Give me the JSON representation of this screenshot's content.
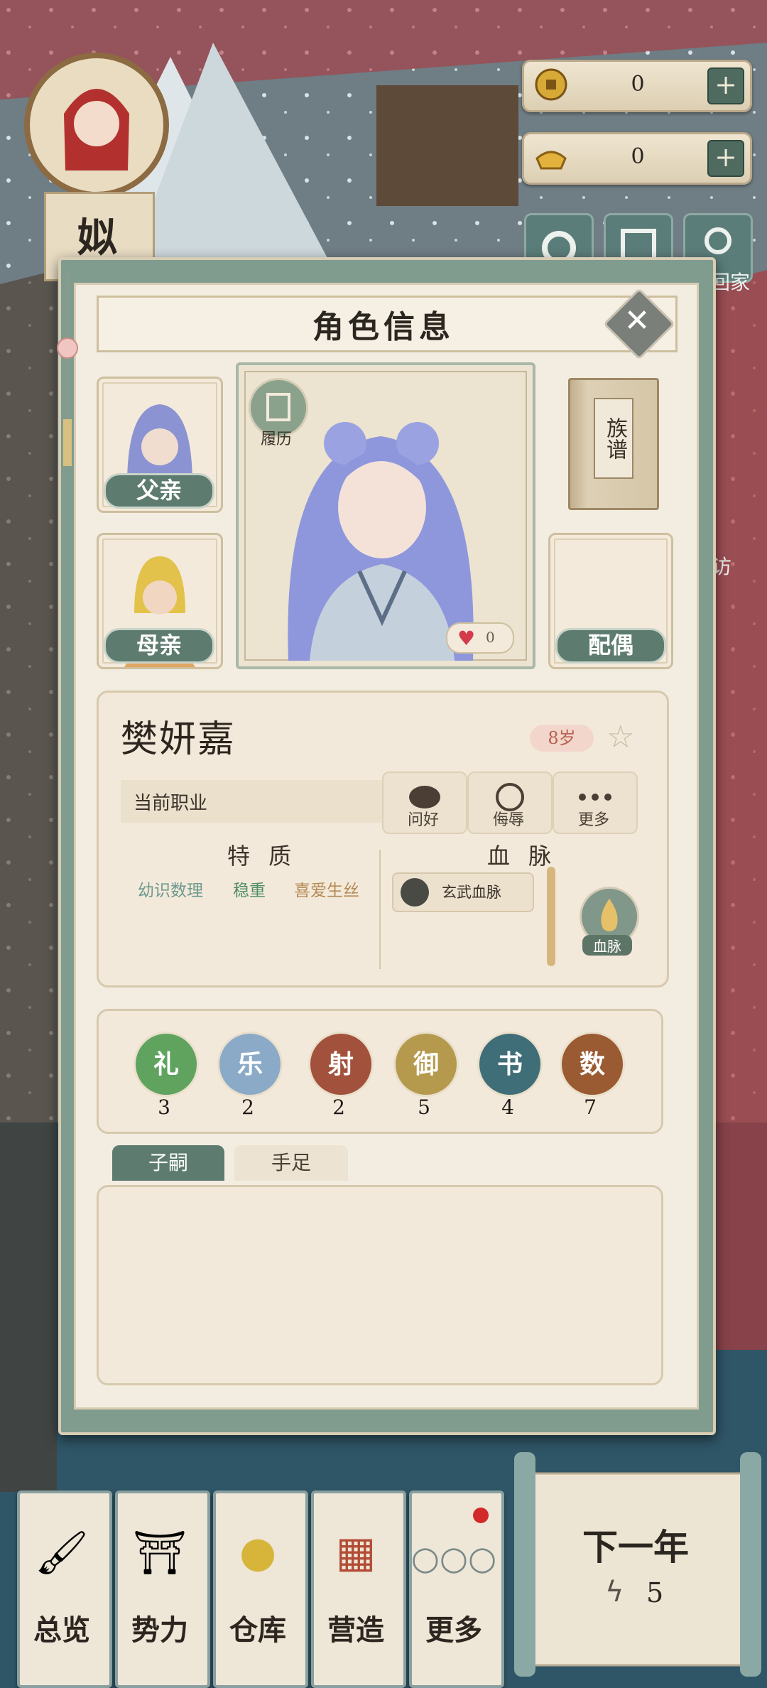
{
  "player": {
    "name_char": "姒"
  },
  "resources": [
    {
      "icon": "copper-coin-icon",
      "value": "0"
    },
    {
      "icon": "gold-ingot-icon",
      "value": "0"
    }
  ],
  "top_buttons": {
    "visit_home_label": "回家",
    "visit_label": "访"
  },
  "panel": {
    "title": "角色信息",
    "resume_label": "履历",
    "genealogy_label": "族谱",
    "father_label": "父亲",
    "mother_label": "母亲",
    "spouse_label": "配偶",
    "affection": "0"
  },
  "character": {
    "name": "樊妍嘉",
    "age": "8岁",
    "job_label": "当前职业",
    "actions": [
      "问好",
      "侮辱",
      "更多"
    ],
    "traits_title": "特 质",
    "traits": [
      "幼识数理",
      "稳重",
      "喜爱生丝"
    ],
    "bloodline_title": "血 脉",
    "bloodline_chip": "玄武血脉",
    "bloodline_button": "血脉"
  },
  "skills": [
    {
      "name": "礼",
      "value": "3",
      "color": "#5fa35f"
    },
    {
      "name": "乐",
      "value": "2",
      "color": "#8aaac8"
    },
    {
      "name": "射",
      "value": "2",
      "color": "#a2523c"
    },
    {
      "name": "御",
      "value": "5",
      "color": "#b59a4e"
    },
    {
      "name": "书",
      "value": "4",
      "color": "#3f6e78"
    },
    {
      "name": "数",
      "value": "7",
      "color": "#9a5a32"
    }
  ],
  "tabs": [
    "子嗣",
    "手足"
  ],
  "bottom_nav": [
    "总览",
    "势力",
    "仓库",
    "营造",
    "更多"
  ],
  "next_year": {
    "label": "下一年",
    "energy": "5"
  },
  "colors": {
    "accent": "#5d7c6f",
    "panel": "#f3ede1"
  }
}
